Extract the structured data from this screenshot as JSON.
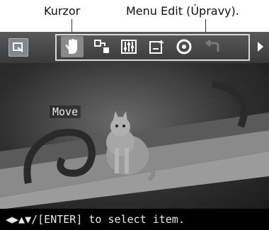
{
  "annotations": {
    "cursor_label": "Kurzor",
    "edit_menu_label": "Menu Edit (Úpravy)."
  },
  "toolbar": {
    "items": [
      {
        "icon": "back-icon"
      },
      {
        "icon": "hand-cursor-icon",
        "selected": true
      },
      {
        "icon": "transfer-icon"
      },
      {
        "icon": "adjust-sliders-icon"
      },
      {
        "icon": "add-frame-icon"
      },
      {
        "icon": "red-eye-icon"
      },
      {
        "icon": "undo-icon"
      },
      {
        "icon": "next-arrow-icon"
      }
    ]
  },
  "preview": {
    "mode_label": "Move",
    "subject": "cat on a wooden bench"
  },
  "status": {
    "hint": "◀▶▲▼/[ENTER] to select item."
  },
  "colors": {
    "toolbar": "#4a4a4a",
    "selected_tool": "#8a8a8a",
    "menu_border": "#d9d9d9",
    "status_bg": "#000000",
    "text": "#e8e8e8"
  }
}
